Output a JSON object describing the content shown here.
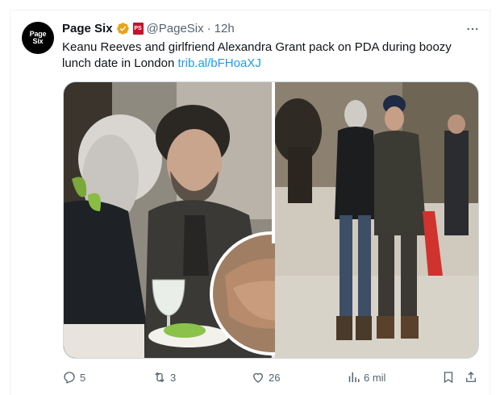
{
  "tweet": {
    "avatar_text_line1": "Page",
    "avatar_text_line2": "Six",
    "display_name": "Page Six",
    "affiliate_badge": "PS",
    "handle": "@PageSix",
    "separator": "·",
    "time": "12h",
    "text": "Keanu Reeves and girlfriend Alexandra Grant pack on PDA during boozy lunch date in London ",
    "link": "trib.al/bFHoaXJ",
    "colors": {
      "link": "#1d9bf0",
      "verified": "#e8a317",
      "secondary_text": "#536471"
    }
  },
  "actions": {
    "reply_count": "5",
    "retweet_count": "3",
    "like_count": "26",
    "views_count": "6 mil",
    "icons": [
      "reply-icon",
      "retweet-icon",
      "like-icon",
      "views-icon",
      "bookmark-icon",
      "share-icon"
    ]
  }
}
